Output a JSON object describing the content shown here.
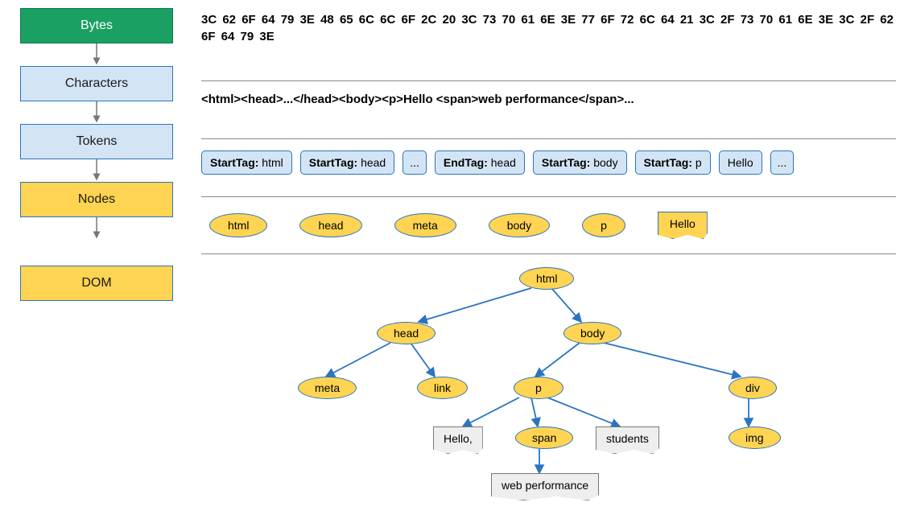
{
  "stages": {
    "bytes": "Bytes",
    "characters": "Characters",
    "tokens": "Tokens",
    "nodes": "Nodes",
    "dom": "DOM"
  },
  "bytes_text": "3C 62 6F 64 79 3E 48 65 6C 6C 6F 2C 20 3C 73 70 61 6E 3E 77 6F 72 6C 64 21 3C 2F 73 70 61 6E 3E 3C 2F 62 6F 64 79 3E",
  "characters_text": "<html><head>...</head><body><p>Hello <span>web performance</span>...",
  "tokens": [
    {
      "tag": "StartTag:",
      "val": " html"
    },
    {
      "tag": "StartTag:",
      "val": " head"
    },
    {
      "tag": "",
      "val": "..."
    },
    {
      "tag": "EndTag:",
      "val": " head"
    },
    {
      "tag": "StartTag:",
      "val": " body"
    },
    {
      "tag": "StartTag:",
      "val": " p"
    },
    {
      "tag": "",
      "val": "Hello"
    },
    {
      "tag": "",
      "val": "..."
    }
  ],
  "nodes_row": {
    "n0": "html",
    "n1": "head",
    "n2": "meta",
    "n3": "body",
    "n4": "p",
    "textnode": "Hello"
  },
  "dom": {
    "html": "html",
    "head": "head",
    "body": "body",
    "meta": "meta",
    "link": "link",
    "p": "p",
    "div": "div",
    "span": "span",
    "img": "img",
    "hello": "Hello,",
    "students": "students",
    "webperf": "web performance"
  }
}
